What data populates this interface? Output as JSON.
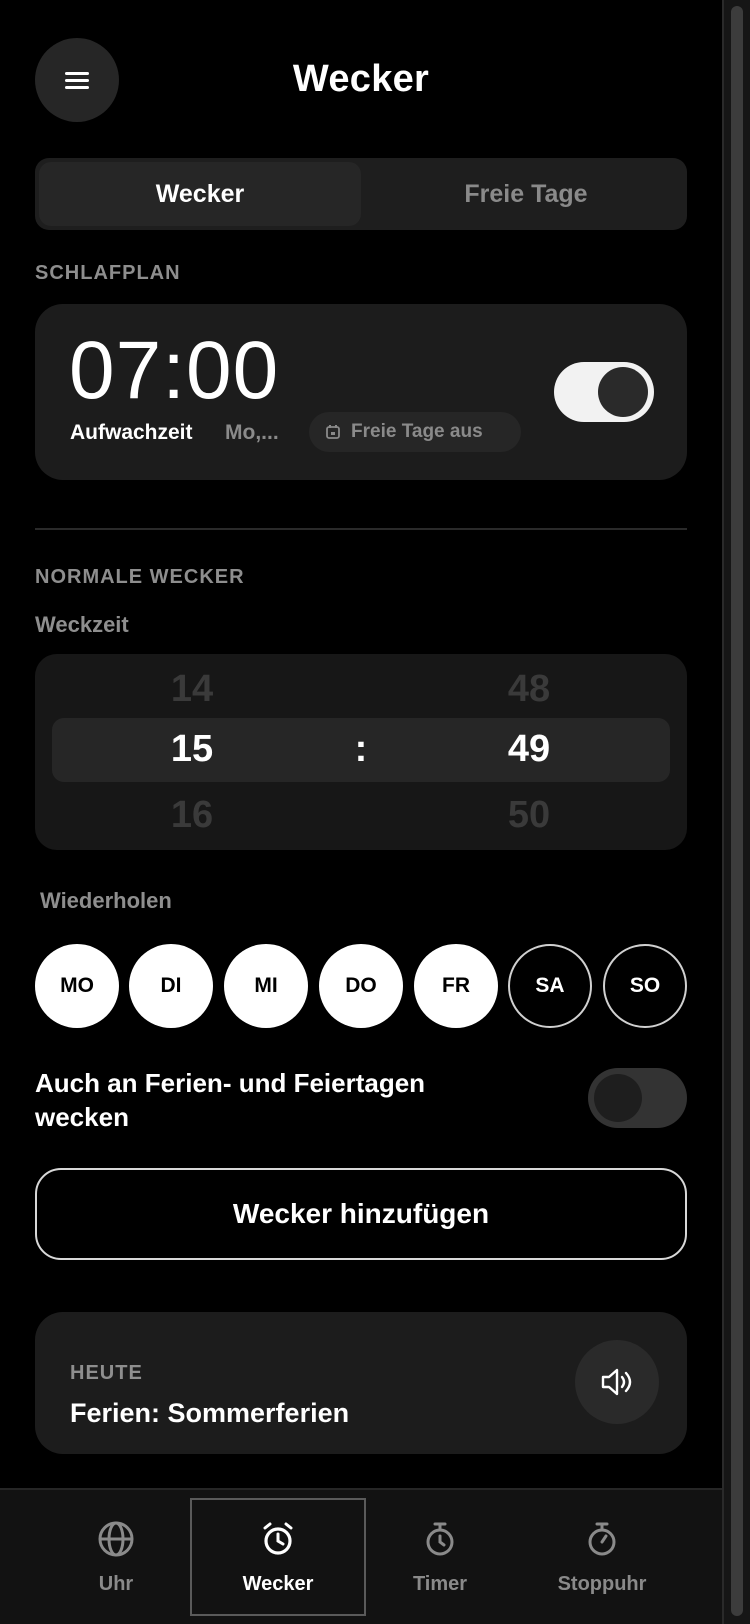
{
  "header": {
    "title": "Wecker",
    "menu_icon": "hamburger-icon"
  },
  "segment": {
    "tabs": [
      {
        "label": "Wecker",
        "active": true
      },
      {
        "label": "Freie Tage",
        "active": false
      }
    ]
  },
  "sleep_schedule": {
    "section_label": "SCHLAFPLAN",
    "time": "07:00",
    "wake_label": "Aufwachzeit",
    "days_summary": "Mo,...",
    "chip_label": "Freie Tage aus",
    "chip_icon": "calendar-icon",
    "enabled": true
  },
  "normal_alarms": {
    "section_label": "NORMALE WECKER",
    "time_label": "Weckzeit",
    "picker": {
      "hours": {
        "prev": "14",
        "selected": "15",
        "next": "16"
      },
      "separator": ":",
      "minutes": {
        "prev": "48",
        "selected": "49",
        "next": "50"
      }
    },
    "repeat_label": "Wiederholen",
    "days": [
      {
        "label": "MO",
        "selected": true
      },
      {
        "label": "DI",
        "selected": true
      },
      {
        "label": "MI",
        "selected": true
      },
      {
        "label": "DO",
        "selected": true
      },
      {
        "label": "FR",
        "selected": true
      },
      {
        "label": "SA",
        "selected": false
      },
      {
        "label": "SO",
        "selected": false
      }
    ],
    "holiday_toggle_label": "Auch an Ferien- und Feiertagen wecken",
    "holiday_toggle_on": false,
    "add_button": "Wecker hinzufügen"
  },
  "today": {
    "label": "HEUTE",
    "text": "Ferien: Sommerferien",
    "sound_icon": "speaker-icon"
  },
  "tabbar": {
    "tabs": [
      {
        "label": "Uhr",
        "icon": "globe-icon",
        "active": false
      },
      {
        "label": "Wecker",
        "icon": "alarm-clock-icon",
        "active": true
      },
      {
        "label": "Timer",
        "icon": "timer-icon",
        "active": false
      },
      {
        "label": "Stoppuhr",
        "icon": "stopwatch-icon",
        "active": false
      }
    ]
  },
  "colors": {
    "background": "#000000",
    "card": "#1c1c1c",
    "muted_text": "#8e8e8e",
    "accent": "#ffffff"
  }
}
